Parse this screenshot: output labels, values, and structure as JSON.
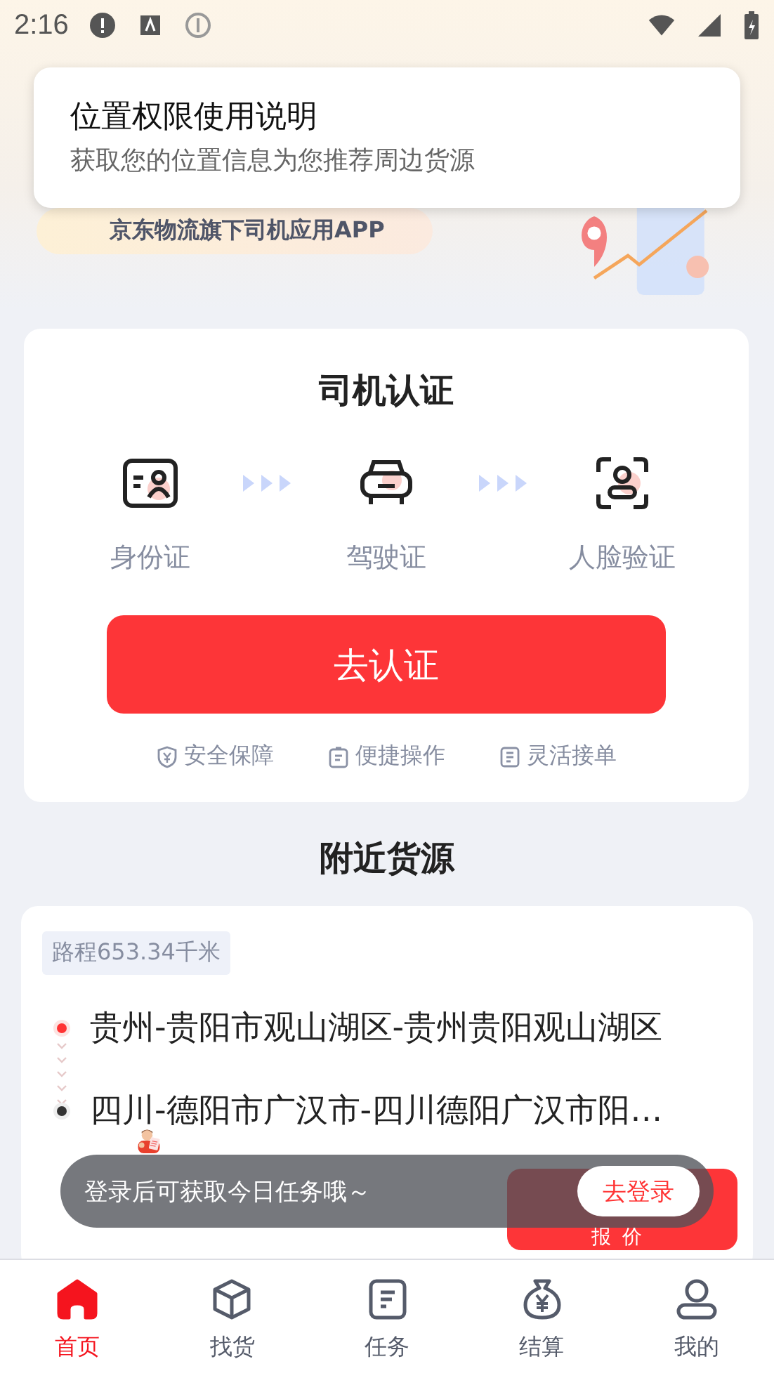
{
  "status_bar": {
    "time": "2:16"
  },
  "permission_popup": {
    "title": "位置权限使用说明",
    "text": "获取您的位置信息为您推荐周边货源"
  },
  "banner": {
    "slogan": "京东物流旗下司机应用APP"
  },
  "certification": {
    "title": "司机认证",
    "steps": [
      {
        "kind": "id",
        "label": "身份证"
      },
      {
        "kind": "car",
        "label": "驾驶证"
      },
      {
        "kind": "face",
        "label": "人脸验证"
      }
    ],
    "button": "去认证",
    "features": [
      {
        "kind": "shield",
        "label": "安全保障"
      },
      {
        "kind": "clipboard",
        "label": "便捷操作"
      },
      {
        "kind": "doc",
        "label": "灵活接单"
      }
    ]
  },
  "nearby": {
    "title": "附近货源",
    "cargo": {
      "distance": "路程653.34千米",
      "from": "贵州-贵阳市观山湖区-贵州贵阳观山湖区",
      "to": "四川-德阳市广汉市-四川德阳广汉市阳…",
      "quote_button": "报价"
    }
  },
  "login_toast": {
    "text": "登录后可获取今日任务哦～",
    "button": "去登录"
  },
  "bottom_nav": [
    {
      "kind": "home",
      "label": "首页",
      "selected": true
    },
    {
      "kind": "box",
      "label": "找货",
      "selected": false
    },
    {
      "kind": "task",
      "label": "任务",
      "selected": false
    },
    {
      "kind": "money",
      "label": "结算",
      "selected": false
    },
    {
      "kind": "user",
      "label": "我的",
      "selected": false
    }
  ]
}
